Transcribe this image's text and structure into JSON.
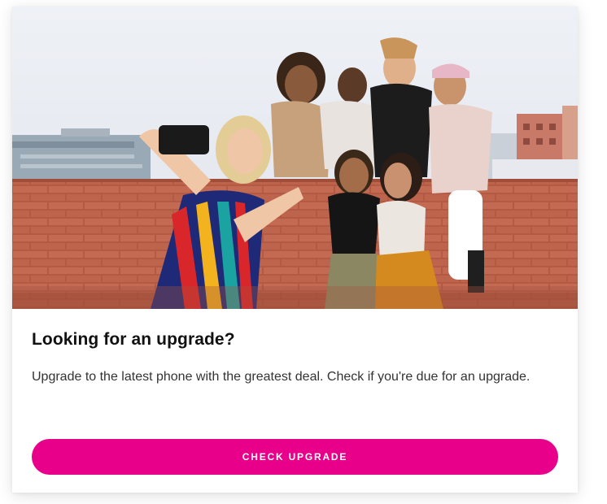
{
  "card": {
    "image_alt": "Group of friends taking a selfie on a rooftop",
    "title": "Looking for an upgrade?",
    "body": "Upgrade to the latest phone with the greatest deal. Check if you're due for an upgrade.",
    "button_label": "CHECK UPGRADE"
  },
  "colors": {
    "accent": "#e8008a",
    "card_background": "#ffffff",
    "title_text": "#111111",
    "body_text": "#333333"
  }
}
